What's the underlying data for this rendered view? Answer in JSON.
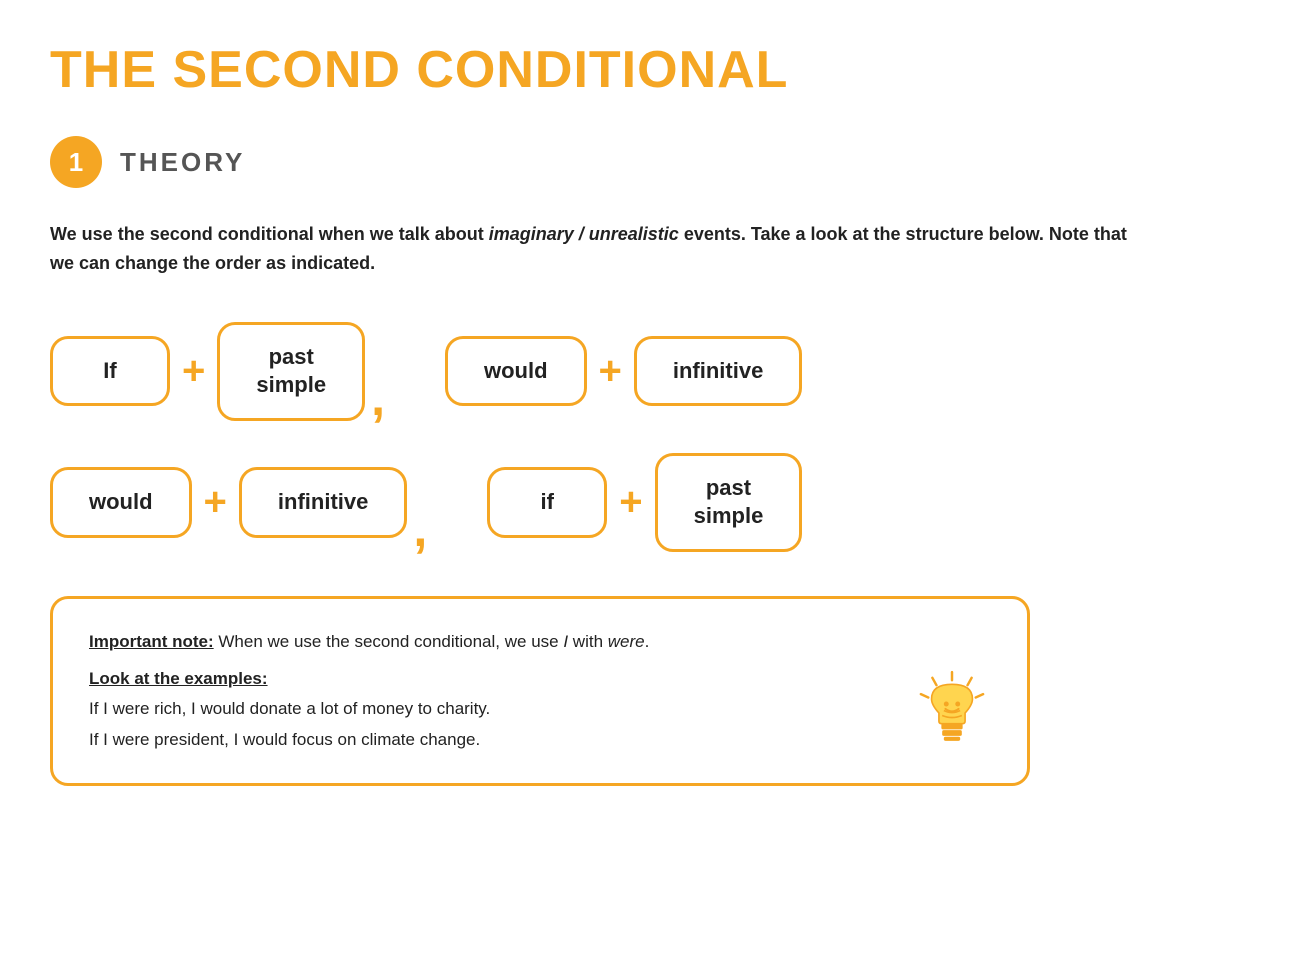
{
  "page": {
    "title": "THE SECOND CONDITIONAL",
    "theory_badge": "1",
    "theory_label": "THEORY",
    "description_parts": {
      "before_italic": "We use the second conditional when we talk about ",
      "italic": "imaginary / unrealistic",
      "after_italic": " events. Take a look at the structure below. Note that we can change the order as indicated."
    },
    "formula_row1": {
      "box1": "If",
      "plus1": "+",
      "box2_line1": "past",
      "box2_line2": "simple",
      "comma": ",",
      "box3": "would",
      "plus2": "+",
      "box4": "infinitive"
    },
    "formula_row2": {
      "box1": "would",
      "plus1": "+",
      "box2": "infinitive",
      "comma": ",",
      "box3": "if",
      "plus2": "+",
      "box4_line1": "past",
      "box4_line2": "simple"
    },
    "note": {
      "important_label": "Important note:",
      "important_text": " When we use the second conditional, we use ",
      "important_italic": "I",
      "important_text2": " with ",
      "important_italic2": "were",
      "important_end": ".",
      "examples_label": "Look at the examples:",
      "example1": "If I were rich, I would donate a lot of money to charity.",
      "example2": "If I were president, I would focus on climate change."
    }
  }
}
